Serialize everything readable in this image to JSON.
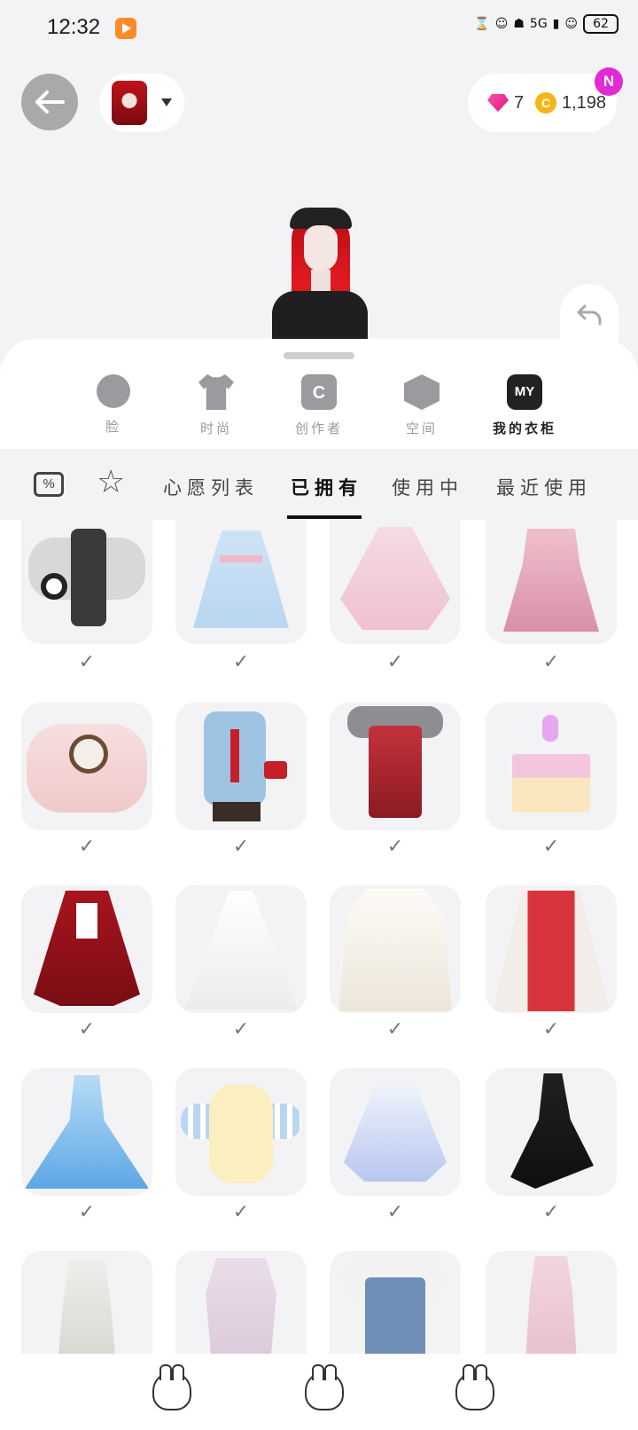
{
  "status": {
    "time": "12:32",
    "network": "5G",
    "battery": "62"
  },
  "header": {
    "gems": "7",
    "coins": "1,198",
    "badge": "N"
  },
  "categories": [
    {
      "label": "脸",
      "icon": "face-icon"
    },
    {
      "label": "时尚",
      "icon": "shirt-icon"
    },
    {
      "label": "创作者",
      "icon": "creator-bag-icon",
      "glyph": "C"
    },
    {
      "label": "空间",
      "icon": "space-cube-icon"
    },
    {
      "label": "我的衣柜",
      "icon": "my-closet-icon",
      "glyph": "MY",
      "active": true
    }
  ],
  "subtabs": {
    "coupon_glyph": "%",
    "items": [
      "心愿列表",
      "已拥有",
      "使用中",
      "最近使用"
    ],
    "active": "已拥有"
  },
  "items": [
    {
      "name": "panda-school-outfit",
      "owned": true
    },
    {
      "name": "blue-lolita-dress",
      "owned": true
    },
    {
      "name": "pink-bow-dress",
      "owned": true
    },
    {
      "name": "pink-lace-dress",
      "owned": true
    },
    {
      "name": "bear-sweater",
      "owned": true
    },
    {
      "name": "blue-shirt-red-tie",
      "owned": true
    },
    {
      "name": "red-corset-dress",
      "owned": true
    },
    {
      "name": "birthday-cake",
      "owned": true
    },
    {
      "name": "red-winter-coat",
      "owned": true
    },
    {
      "name": "white-wedding-gown",
      "owned": true
    },
    {
      "name": "white-hanfu-dress",
      "owned": true
    },
    {
      "name": "red-hanfu-dress",
      "owned": true
    },
    {
      "name": "blue-ball-gown",
      "owned": true
    },
    {
      "name": "cream-bunny-top",
      "owned": true
    },
    {
      "name": "blue-tutu-dress",
      "owned": true
    },
    {
      "name": "black-gothic-dress",
      "owned": true
    },
    {
      "name": "white-long-gloves-dress",
      "owned": false
    },
    {
      "name": "lavender-top",
      "owned": false
    },
    {
      "name": "denim-overalls",
      "owned": false
    },
    {
      "name": "pink-slip-dress",
      "owned": false
    }
  ],
  "check_glyph": "✓",
  "colors": {
    "accent_gem": "#e0268f",
    "coin": "#f5b516",
    "badge": "#e12bd6"
  }
}
